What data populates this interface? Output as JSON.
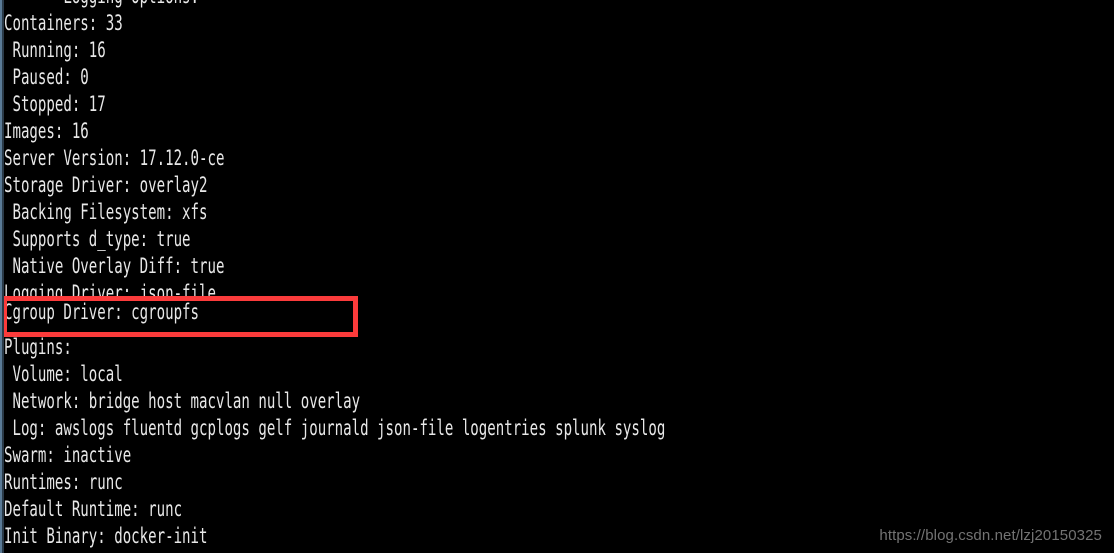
{
  "terminal": {
    "background_color": "#000000",
    "text_color": "#e8e8e8",
    "top_partial_line": "       Logging Options:",
    "lines": [
      "Containers: 33",
      " Running: 16",
      " Paused: 0",
      " Stopped: 17",
      "Images: 16",
      "Server Version: 17.12.0-ce",
      "Storage Driver: overlay2",
      " Backing Filesystem: xfs",
      " Supports d_type: true",
      " Native Overlay Diff: true",
      "Logging Driver: json-file",
      "Cgroup Driver: cgroupfs",
      "Plugins:",
      " Volume: local",
      " Network: bridge host macvlan null overlay",
      " Log: awslogs fluentd gcplogs gelf journald json-file logentries splunk syslog",
      "Swarm: inactive",
      "Runtimes: runc",
      "Default Runtime: runc",
      "Init Binary: docker-init"
    ]
  },
  "annotation": {
    "highlighted_line": "Cgroup Driver: cgroupfs",
    "box_color": "#fb3b3b",
    "box_border_width": 5
  },
  "watermark": {
    "text": "https://blog.csdn.net/lzj20150325",
    "color": "#8d8d8d"
  },
  "window_edge": {
    "color": "#5a7a96"
  }
}
